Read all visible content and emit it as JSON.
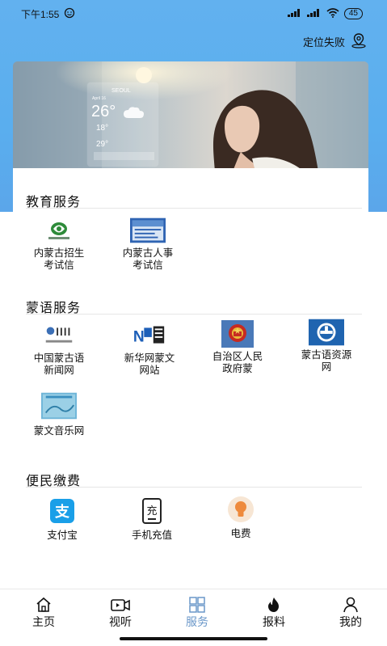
{
  "status_bar": {
    "time": "下午1:55",
    "battery": "45"
  },
  "location": {
    "label": "定位失败"
  },
  "banner": {
    "city": "SEOUL",
    "date": "April 16",
    "temp_main": "26°",
    "temp_a": "18°",
    "temp_b": "29°"
  },
  "sections": [
    {
      "title": "教育服务",
      "items": [
        {
          "label": "内蒙古招生考试信",
          "icon": "nmg-exam-logo-icon"
        },
        {
          "label": "内蒙古人事考试信",
          "icon": "nmg-hr-exam-logo-icon"
        }
      ]
    },
    {
      "title": "蒙语服务",
      "items": [
        {
          "label": "中国蒙古语新闻网",
          "icon": "mongol-news-logo-icon"
        },
        {
          "label": "新华网蒙文网站",
          "icon": "xinhua-news-logo-icon"
        },
        {
          "label": "自治区人民政府蒙",
          "icon": "national-emblem-icon"
        },
        {
          "label": "蒙古语资源网",
          "icon": "mongol-resource-logo-icon"
        },
        {
          "label": "蒙文音乐网",
          "icon": "mongol-music-logo-icon"
        }
      ]
    },
    {
      "title": "便民缴费",
      "items": [
        {
          "label": "支付宝",
          "icon": "alipay-icon"
        },
        {
          "label": "手机充值",
          "icon": "phone-recharge-icon"
        },
        {
          "label": "电费",
          "icon": "electricity-bulb-icon"
        }
      ]
    }
  ],
  "tabs": [
    {
      "label": "主页",
      "icon": "home-icon",
      "active": false
    },
    {
      "label": "视听",
      "icon": "video-icon",
      "active": false
    },
    {
      "label": "服务",
      "icon": "grid-icon",
      "active": true
    },
    {
      "label": "报料",
      "icon": "fire-icon",
      "active": false
    },
    {
      "label": "我的",
      "icon": "person-icon",
      "active": false
    }
  ],
  "colors": {
    "header_blue": "#5aaeee",
    "active_tab": "#6a97c9"
  }
}
